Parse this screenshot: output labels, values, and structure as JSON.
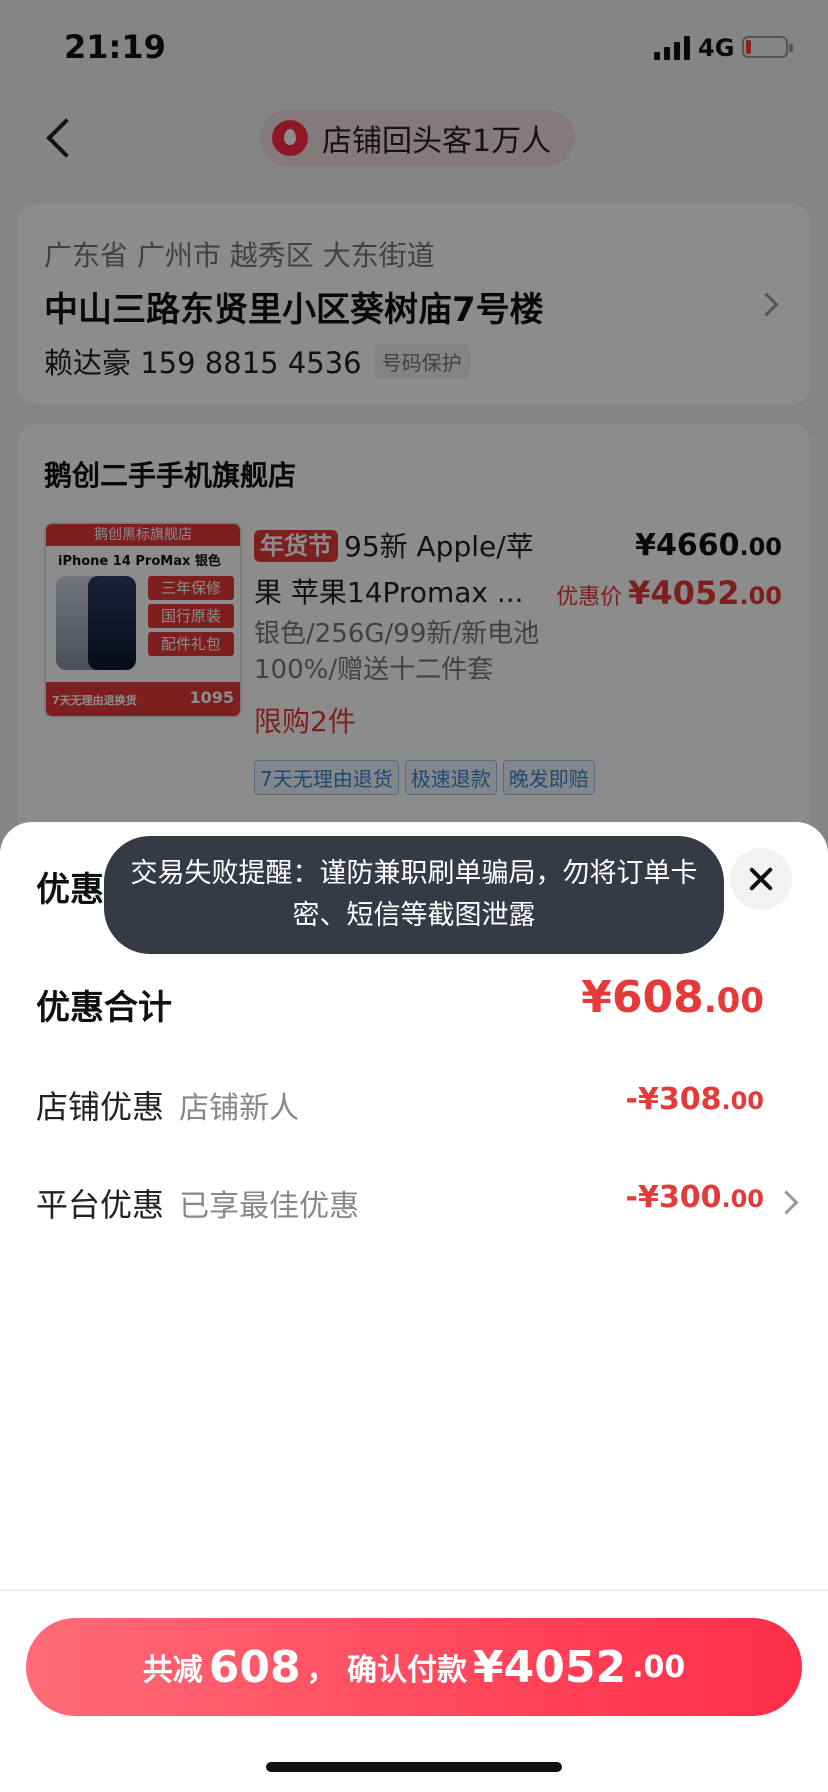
{
  "status_bar": {
    "time": "21:19",
    "network": "4G"
  },
  "header": {
    "pill_text": "店铺回头客1万人"
  },
  "address": {
    "region": "广东省 广州市 越秀区 大东街道",
    "street": "中山三路东贤里小区葵树庙7号楼",
    "name_phone": "赖达豪 159 8815 4536",
    "privacy_tag": "号码保护"
  },
  "shop": {
    "name": "鹅创二手手机旗舰店",
    "thumbnail": {
      "top": "鹅创黑标旗舰店",
      "model": "iPhone 14 ProMax 银色",
      "features": [
        "三年保修",
        "国行原装",
        "配件礼包"
      ],
      "days": "7天无理由退换货",
      "price": "1095"
    },
    "product": {
      "badge": "年货节",
      "title": "95新 Apple/苹果 苹果14Promax ...",
      "spec": "银色/256G/99新/新电池100%/赠送十二件套",
      "limit": "限购2件",
      "price_original_int": "¥4660",
      "price_original_dec": ".00",
      "deal_label": "优惠价",
      "price_deal_int": "¥4052",
      "price_deal_dec": ".00",
      "service_tags": [
        "7天无理由退货",
        "极速退款",
        "晚发即赔"
      ]
    }
  },
  "sheet": {
    "title": "优惠",
    "total_label": "优惠合计",
    "total_int": "¥608",
    "total_dec": ".00",
    "rows": [
      {
        "label": "店铺优惠",
        "sub": "店铺新人",
        "amount_int": "-¥308",
        "amount_dec": ".00"
      },
      {
        "label": "平台优惠",
        "sub": "已享最佳优惠",
        "amount_int": "-¥300",
        "amount_dec": ".00"
      }
    ]
  },
  "pay_button": {
    "prefix": "共减",
    "reduce": "608",
    "middle": "， 确认付款",
    "amount_int": "¥4052",
    "amount_dec": ".00"
  },
  "toast": "交易失败提醒：谨防兼职刷单骗局，勿将订单卡密、短信等截图泄露",
  "colors": {
    "accent": "#e53a3a",
    "toast_bg": "#353a45"
  }
}
